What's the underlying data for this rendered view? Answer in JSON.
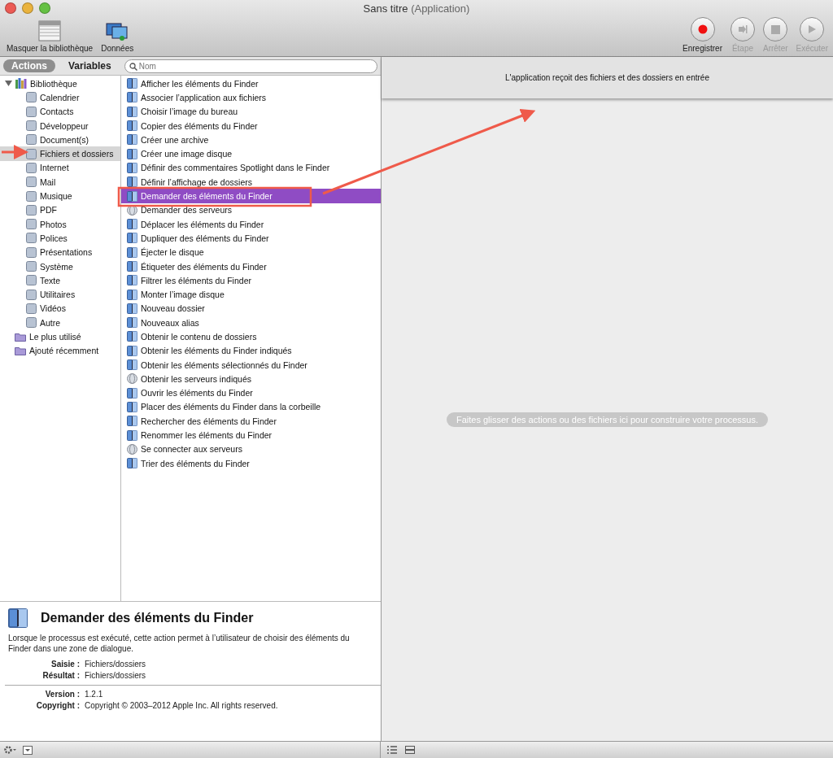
{
  "window": {
    "title": "Sans titre",
    "subtitle": "(Application)"
  },
  "toolbar": {
    "left": [
      {
        "label": "Masquer la bibliothèque",
        "kind": "library"
      },
      {
        "label": "Données",
        "kind": "media"
      }
    ],
    "right": [
      {
        "label": "Enregistrer",
        "kind": "record",
        "disabled": false
      },
      {
        "label": "Étape",
        "kind": "step",
        "disabled": true
      },
      {
        "label": "Arrêter",
        "kind": "stop",
        "disabled": true
      },
      {
        "label": "Exécuter",
        "kind": "run",
        "disabled": true
      }
    ]
  },
  "tabs": [
    {
      "label": "Actions",
      "selected": true
    },
    {
      "label": "Variables",
      "selected": false
    }
  ],
  "search": {
    "placeholder": "Nom"
  },
  "library": {
    "label": "Bibliothèque",
    "expanded": true,
    "children": [
      {
        "label": "Calendrier",
        "selected": false
      },
      {
        "label": "Contacts",
        "selected": false
      },
      {
        "label": "Développeur",
        "selected": false
      },
      {
        "label": "Document(s)",
        "selected": false
      },
      {
        "label": "Fichiers et dossiers",
        "selected": true
      },
      {
        "label": "Internet",
        "selected": false
      },
      {
        "label": "Mail",
        "selected": false
      },
      {
        "label": "Musique",
        "selected": false
      },
      {
        "label": "PDF",
        "selected": false
      },
      {
        "label": "Photos",
        "selected": false
      },
      {
        "label": "Polices",
        "selected": false
      },
      {
        "label": "Présentations",
        "selected": false
      },
      {
        "label": "Système",
        "selected": false
      },
      {
        "label": "Texte",
        "selected": false
      },
      {
        "label": "Utilitaires",
        "selected": false
      },
      {
        "label": "Vidéos",
        "selected": false
      },
      {
        "label": "Autre",
        "selected": false
      }
    ]
  },
  "smart_groups": [
    {
      "label": "Le plus utilisé",
      "selected": false
    },
    {
      "label": "Ajouté récemment",
      "selected": false
    }
  ],
  "actions": [
    {
      "label": "Afficher les éléments du Finder",
      "kind": "finder",
      "selected": false
    },
    {
      "label": "Associer l’application aux fichiers",
      "kind": "finder",
      "selected": false
    },
    {
      "label": "Choisir l’image du bureau",
      "kind": "finder",
      "selected": false
    },
    {
      "label": "Copier des éléments du Finder",
      "kind": "finder",
      "selected": false
    },
    {
      "label": "Créer une archive",
      "kind": "finder",
      "selected": false
    },
    {
      "label": "Créer une image disque",
      "kind": "finder",
      "selected": false
    },
    {
      "label": "Définir des commentaires Spotlight dans le Finder",
      "kind": "finder",
      "selected": false
    },
    {
      "label": "Définir l’affichage de dossiers",
      "kind": "finder",
      "selected": false
    },
    {
      "label": "Demander des éléments du Finder",
      "kind": "finder",
      "selected": true
    },
    {
      "label": "Demander des serveurs",
      "kind": "server",
      "selected": false
    },
    {
      "label": "Déplacer les éléments du Finder",
      "kind": "finder",
      "selected": false
    },
    {
      "label": "Dupliquer des éléments du Finder",
      "kind": "finder",
      "selected": false
    },
    {
      "label": "Éjecter le disque",
      "kind": "finder",
      "selected": false
    },
    {
      "label": "Étiqueter des éléments du Finder",
      "kind": "finder",
      "selected": false
    },
    {
      "label": "Filtrer les éléments du Finder",
      "kind": "finder",
      "selected": false
    },
    {
      "label": "Monter l’image disque",
      "kind": "finder",
      "selected": false
    },
    {
      "label": "Nouveau dossier",
      "kind": "finder",
      "selected": false
    },
    {
      "label": "Nouveaux alias",
      "kind": "finder",
      "selected": false
    },
    {
      "label": "Obtenir le contenu de dossiers",
      "kind": "finder",
      "selected": false
    },
    {
      "label": "Obtenir les éléments du Finder indiqués",
      "kind": "finder",
      "selected": false
    },
    {
      "label": "Obtenir les éléments sélectionnés du Finder",
      "kind": "finder",
      "selected": false
    },
    {
      "label": "Obtenir les serveurs indiqués",
      "kind": "server",
      "selected": false
    },
    {
      "label": "Ouvrir les éléments du Finder",
      "kind": "finder",
      "selected": false
    },
    {
      "label": "Placer des éléments du Finder dans la corbeille",
      "kind": "finder",
      "selected": false
    },
    {
      "label": "Rechercher des éléments du Finder",
      "kind": "finder",
      "selected": false
    },
    {
      "label": "Renommer les éléments du Finder",
      "kind": "finder",
      "selected": false
    },
    {
      "label": "Se connecter aux serveurs",
      "kind": "server",
      "selected": false
    },
    {
      "label": "Trier des éléments du Finder",
      "kind": "finder",
      "selected": false
    }
  ],
  "description": {
    "title": "Demander des éléments du Finder",
    "text": "Lorsque le processus est exécuté, cette action permet à l’utilisateur de choisir des éléments du Finder dans une zone de dialogue.",
    "io_fields": [
      {
        "label": "Saisie :",
        "value": "Fichiers/dossiers"
      },
      {
        "label": "Résultat :",
        "value": "Fichiers/dossiers"
      }
    ],
    "info_fields": [
      {
        "label": "Version :",
        "value": "1.2.1"
      },
      {
        "label": "Copyright :",
        "value": "Copyright © 2003–2012 Apple Inc.  All rights reserved."
      }
    ]
  },
  "workflow": {
    "header": "L'application reçoit des fichiers et des dossiers en entrée",
    "hint": "Faites glisser des actions ou des fichiers ici pour construire votre processus."
  }
}
